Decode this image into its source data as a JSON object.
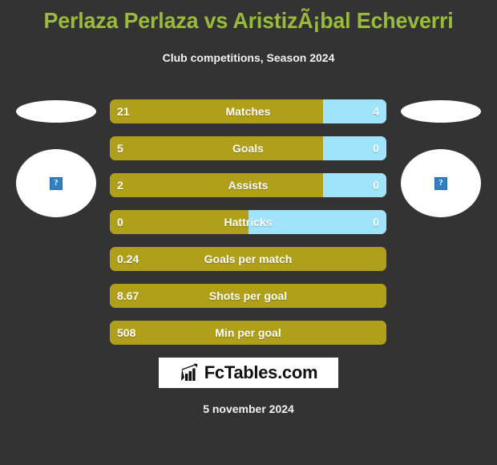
{
  "header": {
    "title": "Perlaza Perlaza vs AristizÃ¡bal Echeverri",
    "subtitle": "Club competitions, Season 2024"
  },
  "players": {
    "left": {
      "flag_placeholder": "flag-oval",
      "photo_placeholder": "broken-image-icon",
      "broken_glyph": "?"
    },
    "right": {
      "flag_placeholder": "flag-oval",
      "photo_placeholder": "broken-image-icon",
      "broken_glyph": "?"
    }
  },
  "colors": {
    "background": "#333333",
    "title": "#9aba3c",
    "bar_left": "#b0a019",
    "bar_right": "#a0e4fb",
    "text": "#ffffff"
  },
  "chart_data": {
    "type": "bar",
    "title": "Perlaza Perlaza vs AristizÃ¡bal Echeverri",
    "subtitle": "Club competitions, Season 2024",
    "categories": [
      "Matches",
      "Goals",
      "Assists",
      "Hattricks",
      "Goals per match",
      "Shots per goal",
      "Min per goal"
    ],
    "series": [
      {
        "name": "Perlaza Perlaza",
        "values": [
          "21",
          "5",
          "2",
          "0",
          "0.24",
          "8.67",
          "508"
        ]
      },
      {
        "name": "AristizÃ¡bal Echeverri",
        "values": [
          "4",
          "0",
          "0",
          "0",
          null,
          null,
          null
        ]
      }
    ],
    "rows": [
      {
        "label": "Matches",
        "left": "21",
        "right": "4",
        "left_pct": 77,
        "split": true
      },
      {
        "label": "Goals",
        "left": "5",
        "right": "0",
        "left_pct": 77,
        "split": true
      },
      {
        "label": "Assists",
        "left": "2",
        "right": "0",
        "left_pct": 77,
        "split": true
      },
      {
        "label": "Hattricks",
        "left": "0",
        "right": "0",
        "left_pct": 50,
        "split": true
      },
      {
        "label": "Goals per match",
        "left": "0.24",
        "right": "",
        "left_pct": 100,
        "split": false
      },
      {
        "label": "Shots per goal",
        "left": "8.67",
        "right": "",
        "left_pct": 100,
        "split": false
      },
      {
        "label": "Min per goal",
        "left": "508",
        "right": "",
        "left_pct": 100,
        "split": false
      }
    ],
    "legend_position": "none",
    "grid": false
  },
  "footer": {
    "logo_text": "FcTables.com",
    "logo_icon": "bar-chart-arrow-icon",
    "date": "5 november 2024"
  }
}
